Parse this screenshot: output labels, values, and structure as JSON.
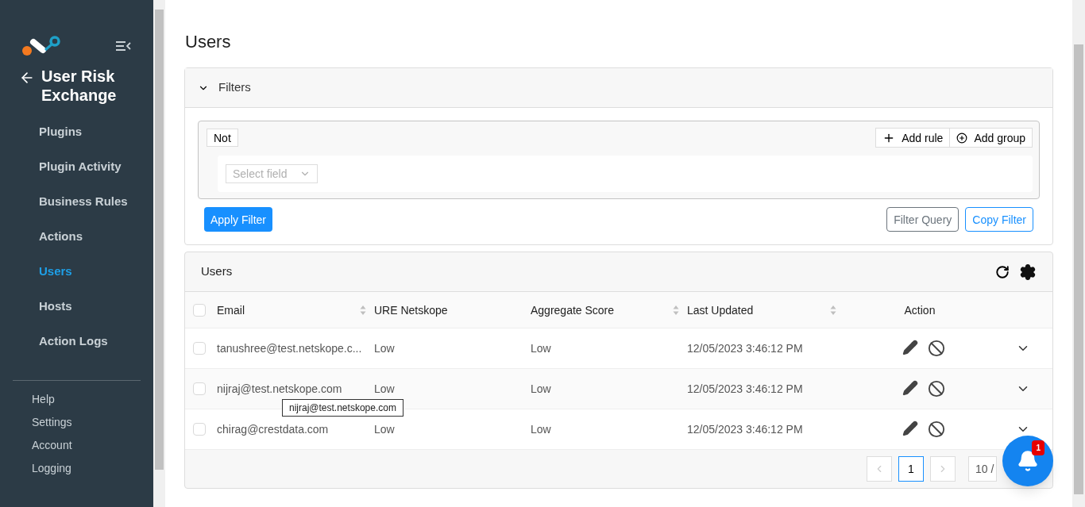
{
  "sidebar": {
    "back_title": "User Risk Exchange",
    "items": [
      {
        "label": "Plugins",
        "selected": false
      },
      {
        "label": "Plugin Activity",
        "selected": false
      },
      {
        "label": "Business Rules",
        "selected": false
      },
      {
        "label": "Actions",
        "selected": false
      },
      {
        "label": "Users",
        "selected": true
      },
      {
        "label": "Hosts",
        "selected": false
      },
      {
        "label": "Action Logs",
        "selected": false
      }
    ],
    "footer_items": [
      "Help",
      "Settings",
      "Account",
      "Logging"
    ]
  },
  "page_title": "Users",
  "filters": {
    "title": "Filters",
    "expanded": true,
    "not_label": "Not",
    "add_rule": "Add rule",
    "add_group": "Add group",
    "field_placeholder": "Select field",
    "apply": "Apply Filter",
    "filter_query": "Filter Query",
    "copy_filter": "Copy Filter"
  },
  "table": {
    "title": "Users",
    "all_checked": false,
    "columns": [
      {
        "label": "Email",
        "sortable": true
      },
      {
        "label": "URE Netskope",
        "sortable": false
      },
      {
        "label": "Aggregate Score",
        "sortable": true
      },
      {
        "label": "Last Updated",
        "sortable": true
      },
      {
        "label": "Action",
        "sortable": false
      }
    ],
    "rows": [
      {
        "checked": false,
        "email": "tanushree@test.netskope.c...",
        "ure": "Low",
        "score": "Low",
        "updated": "12/05/2023 3:46:12 PM"
      },
      {
        "checked": false,
        "email": "nijraj@test.netskope.com",
        "ure": "Low",
        "score": "Low",
        "updated": "12/05/2023 3:46:12 PM",
        "tooltip": "nijraj@test.netskope.com"
      },
      {
        "checked": false,
        "email": "chirag@crestdata.com",
        "ure": "Low",
        "score": "Low",
        "updated": "12/05/2023 3:46:12 PM"
      }
    ],
    "pagination": {
      "pages": [
        {
          "label": "1",
          "selected": true
        }
      ],
      "page_size": "10 /"
    }
  },
  "notifications": {
    "count": "1"
  }
}
